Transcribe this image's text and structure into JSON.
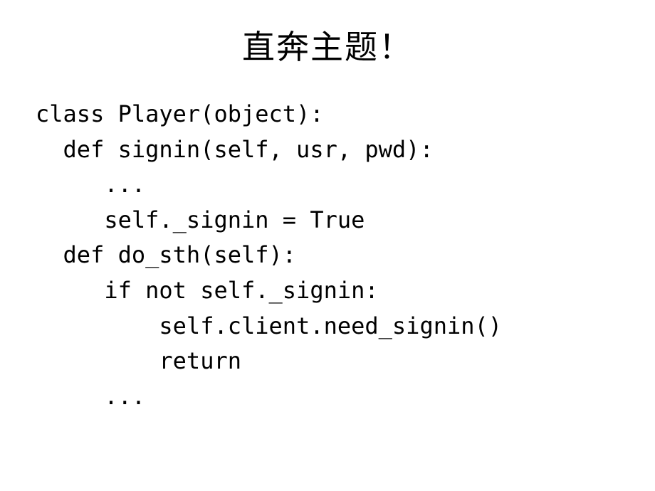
{
  "title": "直奔主题！",
  "code": {
    "line1": "class Player(object):",
    "line2": "  def signin(self, usr, pwd):",
    "line3": "     ...",
    "line4": "     self._signin = True",
    "line5": "  def do_sth(self):",
    "line6": "     if not self._signin:",
    "line7": "         self.client.need_signin()",
    "line8": "         return",
    "line9": "     ..."
  }
}
